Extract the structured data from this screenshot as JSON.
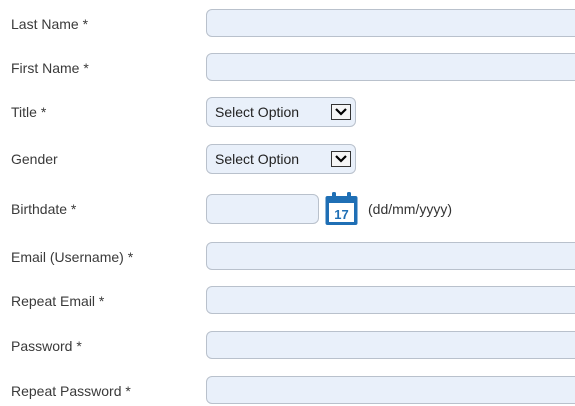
{
  "form": {
    "last_name": {
      "label": "Last Name *",
      "value": ""
    },
    "first_name": {
      "label": "First Name *",
      "value": ""
    },
    "title": {
      "label": "Title *",
      "selected": "Select Option"
    },
    "gender": {
      "label": "Gender",
      "selected": "Select Option"
    },
    "birthdate": {
      "label": "Birthdate *",
      "value": "",
      "calendar_day": "17",
      "format_hint": "(dd/mm/yyyy)",
      "calendar_icon": "calendar-icon",
      "calendar_color": "#1f6fb5"
    },
    "email": {
      "label": "Email (Username) *",
      "value": ""
    },
    "repeat_email": {
      "label": "Repeat Email *",
      "value": ""
    },
    "password": {
      "label": "Password *",
      "value": ""
    },
    "repeat_password": {
      "label": "Repeat Password *",
      "value": ""
    }
  },
  "colors": {
    "input_bg": "#e9f0fa",
    "input_border": "#b9c1cc",
    "label_text": "#3a3a3a"
  }
}
